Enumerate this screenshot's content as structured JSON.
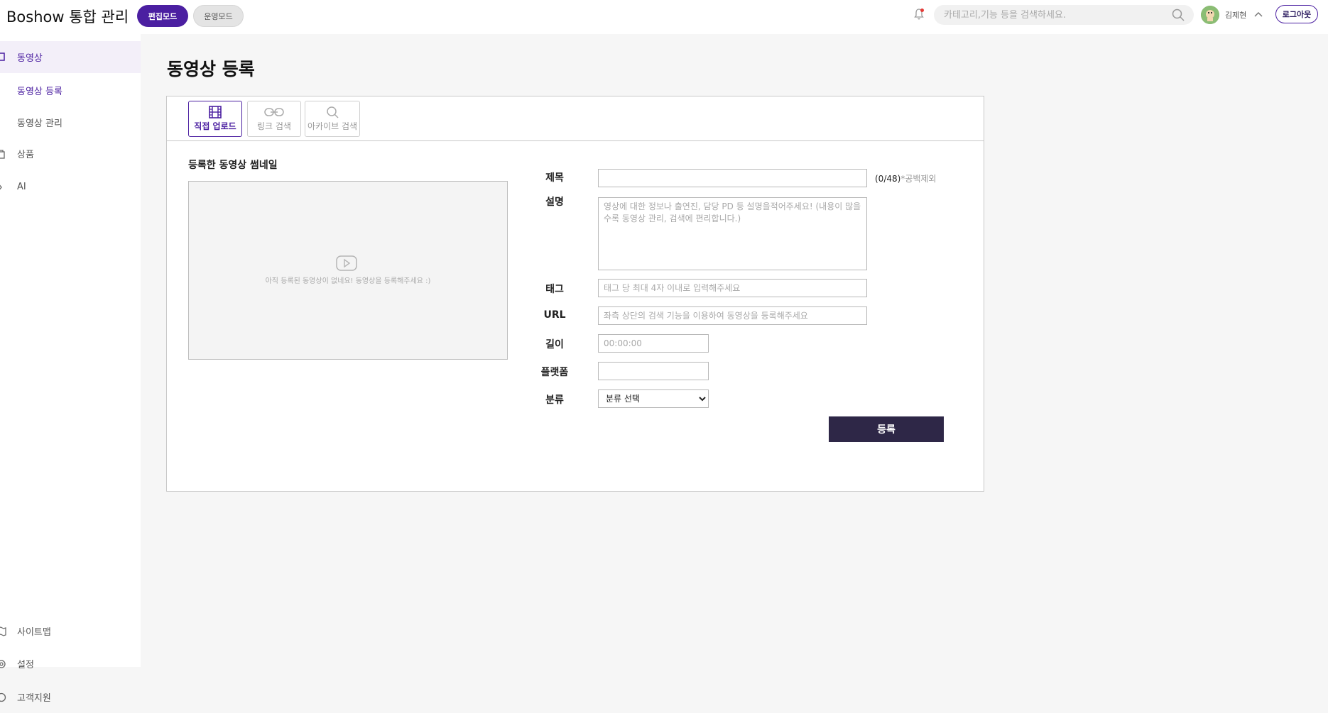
{
  "header": {
    "app_title": "Boshow 통합 관리",
    "mode_edit": "편집모드",
    "mode_ops": "운영모드",
    "search_placeholder": "카테고리,기능 등을 검색하세요.",
    "user_name": "김제현",
    "logout_label": "로그아웃"
  },
  "sidebar": {
    "items": [
      {
        "label": "동영상",
        "icon": "square-icon"
      },
      {
        "label": "동영상 등록"
      },
      {
        "label": "동영상 관리"
      },
      {
        "label": "상품",
        "icon": "bag-icon"
      },
      {
        "label": "AI",
        "icon": "ai-icon"
      },
      {
        "label": "사이트맵",
        "icon": "map-icon"
      },
      {
        "label": "설정",
        "icon": "gear-icon"
      },
      {
        "label": "고객지원",
        "icon": "support-icon"
      }
    ]
  },
  "main": {
    "title": "동영상 등록",
    "tabs": [
      {
        "label": "직접 업로드",
        "icon": "film-icon",
        "active": true
      },
      {
        "label": "링크 검색",
        "icon": "link-icon",
        "active": false
      },
      {
        "label": "아카이브 검색",
        "icon": "search-icon",
        "active": false
      }
    ],
    "thumbnail": {
      "label": "등록한 동영상 썸네일",
      "empty_message": "아직 등록된 동영상이 없네요! 동영상을 등록해주세요 :)"
    },
    "form": {
      "title_label": "제목",
      "title_value": "",
      "title_counter": "(0/48)",
      "title_counter_hint": "*공백제외",
      "desc_label": "설명",
      "desc_placeholder": "영상에 대한 정보나 출연진, 담당 PD 등 설명을적어주세요! (내용이 많을수록 동영상 관리, 검색에 편리합니다.)",
      "tag_label": "태그",
      "tag_placeholder": "태그 당 최대 4자 이내로 입력해주세요",
      "url_label": "URL",
      "url_placeholder": "좌측 상단의 검색 기능을 이용하여 동영상을 등록해주세요",
      "length_label": "길이",
      "length_placeholder": "00:00:00",
      "platform_label": "플랫폼",
      "platform_value": "",
      "category_label": "분류",
      "category_selected": "분류 선택",
      "submit_label": "등록"
    }
  },
  "colors": {
    "accent": "#4b1fa1",
    "submit_bg": "#2e2747"
  }
}
